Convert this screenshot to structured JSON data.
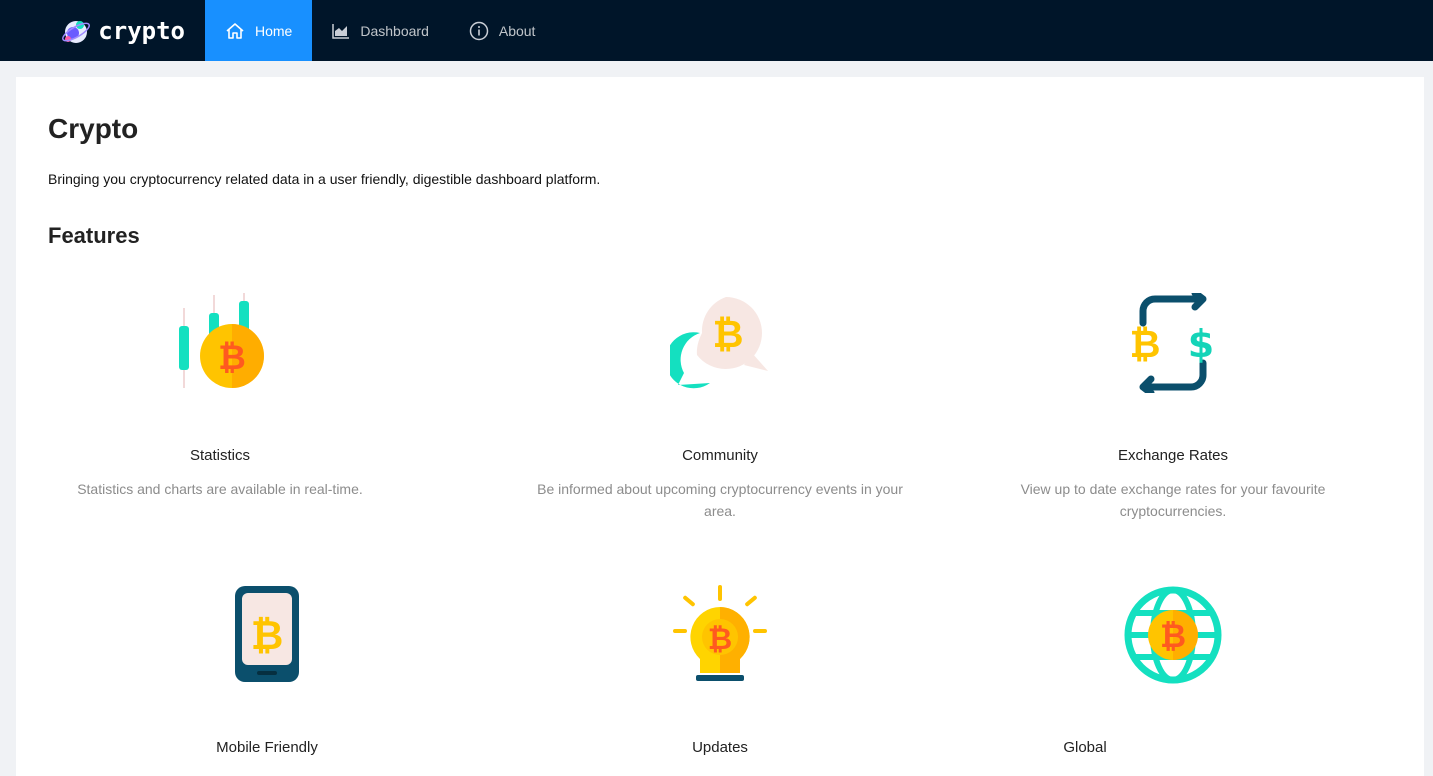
{
  "nav": {
    "logo_text": "crypto",
    "items": [
      {
        "label": "Home",
        "icon": "home-icon",
        "active": true
      },
      {
        "label": "Dashboard",
        "icon": "area-chart-icon",
        "active": false
      },
      {
        "label": "About",
        "icon": "info-circle-icon",
        "active": false
      }
    ]
  },
  "page": {
    "title": "Crypto",
    "subtitle": "Bringing you cryptocurrency related data in a user friendly, digestible dashboard platform.",
    "features_heading": "Features"
  },
  "features": [
    {
      "title": "Statistics",
      "description": "Statistics and charts are available in real-time.",
      "icon": "candlestick-bitcoin-icon"
    },
    {
      "title": "Community",
      "description": "Be informed about upcoming cryptocurrency events in your area.",
      "icon": "chat-bitcoin-icon"
    },
    {
      "title": "Exchange Rates",
      "description": "View up to date exchange rates for your favourite cryptocurrencies.",
      "icon": "exchange-bitcoin-dollar-icon"
    },
    {
      "title": "Mobile Friendly",
      "description": "",
      "icon": "phone-bitcoin-icon"
    },
    {
      "title": "Updates",
      "description": "",
      "icon": "lightbulb-bitcoin-icon"
    },
    {
      "title": "Global",
      "description": "",
      "icon": "globe-bitcoin-icon"
    }
  ],
  "colors": {
    "nav_bg": "#001529",
    "nav_active": "#1890ff",
    "teal": "#14e0c0",
    "gold": "#ffc400",
    "orange": "#ff8a00",
    "dark_teal": "#0b4f6c"
  }
}
